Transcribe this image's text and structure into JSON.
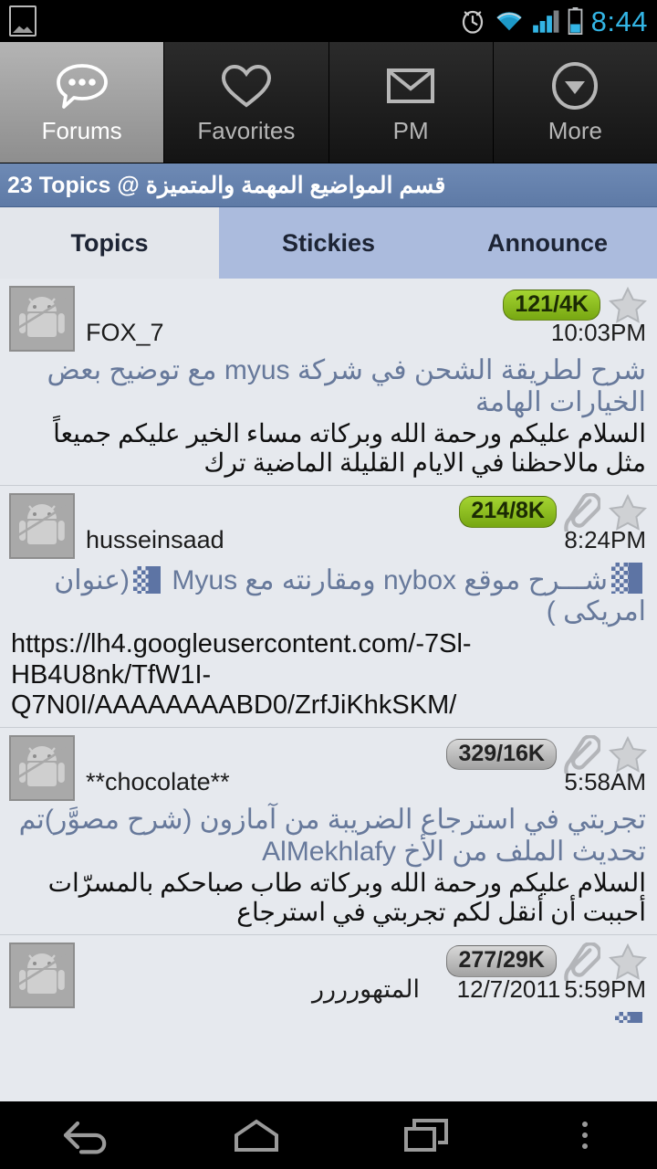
{
  "status_bar": {
    "time": "8:44",
    "icons": [
      "gallery-icon",
      "alarm-icon",
      "wifi-icon",
      "signal-icon",
      "battery-icon"
    ],
    "time_color": "#33b5e5"
  },
  "top_tabs": [
    {
      "label": "Forums",
      "icon": "speech-bubble-icon",
      "active": true
    },
    {
      "label": "Favorites",
      "icon": "heart-icon",
      "active": false
    },
    {
      "label": "PM",
      "icon": "envelope-icon",
      "active": false
    },
    {
      "label": "More",
      "icon": "chevron-down-circle-icon",
      "active": false
    }
  ],
  "forum_header": {
    "text": "23 Topics @ قسم المواضيع المهمة والمتميزة",
    "topic_count": "23 Topics",
    "forum_name": "قسم المواضيع المهمة والمتميزة",
    "background": "#5e7aa6"
  },
  "sub_tabs": [
    {
      "label": "Topics",
      "active": true
    },
    {
      "label": "Stickies",
      "active": false
    },
    {
      "label": "Announce",
      "active": false
    }
  ],
  "posts": [
    {
      "avatar": "android-robot-avatar",
      "username": "FOX_7",
      "count": "121/4K",
      "count_style": "green",
      "has_attachment": false,
      "starred": false,
      "date": "",
      "time": "10:03PM",
      "title": "شرح لطريقة الشحن في شركة myus مع توضيح بعض الخيارات الهامة",
      "preview": "السلام عليكم ورحمة الله وبركاته   مساء الخير عليكم جميعاً   مثل مالاحظنا في الايام القليلة الماضية ترك"
    },
    {
      "avatar": "android-robot-avatar",
      "username": "husseinsaad",
      "count": "214/8K",
      "count_style": "green",
      "has_attachment": true,
      "starred": false,
      "date": "",
      "time": "8:24PM",
      "title_pre_tofu": "شـــرح موقع nybox ومقارنته مع Myus",
      "title_post_tofu": "(عنوان امريكى )",
      "preview": "https://lh4.googleusercontent.com/-7Sl-HB4U8nk/TfW1I-Q7N0I/AAAAAAAABD0/ZrfJiKhkSKM/"
    },
    {
      "avatar": "android-robot-avatar",
      "username": "**chocolate**",
      "count": "329/16K",
      "count_style": "gray",
      "has_attachment": true,
      "starred": false,
      "date": "",
      "time": "5:58AM",
      "title": "تجربتي في استرجاع الضريبة من آمازون (شرح مصوَّر)تم تحديث الملف من الأخ AlMekhlafy",
      "preview": "السلام عليكم ورحمة الله وبركاته طاب صباحكم بالمسرّات أحببت أن أنقل لكم تجربتي في استرجاع"
    },
    {
      "avatar": "android-robot-avatar",
      "username": "المتهورررر",
      "count": "277/29K",
      "count_style": "gray",
      "has_attachment": true,
      "starred": false,
      "date": "12/7/2011",
      "time": "5:59PM",
      "title": "",
      "preview": ""
    }
  ],
  "nav_bar": {
    "buttons": [
      "back-icon",
      "home-icon",
      "recents-icon",
      "overflow-menu-icon"
    ]
  },
  "colors": {
    "accent_blue": "#5e7aa6",
    "subtab_inactive": "#abbbdd",
    "list_bg": "#e6e9ee",
    "title_text": "#67799b",
    "badge_green": "#8dbf1f",
    "badge_gray": "#bcbcbc"
  }
}
